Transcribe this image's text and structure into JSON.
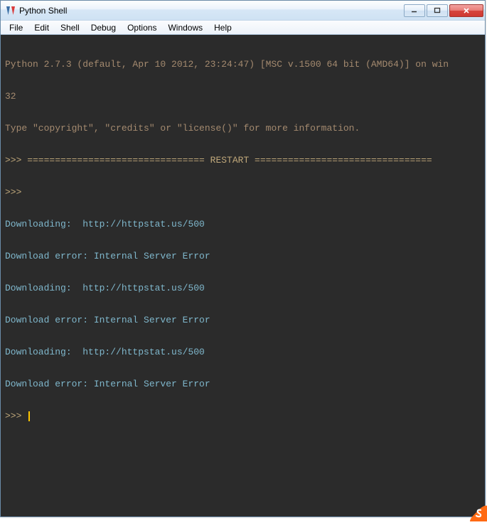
{
  "window": {
    "title": "Python Shell",
    "icon": "tk-icon",
    "controls": {
      "minimize": "─",
      "maximize": "☐",
      "close": "✕"
    }
  },
  "menu": {
    "items": [
      "File",
      "Edit",
      "Shell",
      "Debug",
      "Options",
      "Windows",
      "Help"
    ]
  },
  "console": {
    "header1": "Python 2.7.3 (default, Apr 10 2012, 23:24:47) [MSC v.1500 64 bit (AMD64)] on win",
    "header2": "32",
    "header3": "Type \"copyright\", \"credits\" or \"license()\" for more information.",
    "prompt": ">>> ",
    "restart_line": ">>> ================================ RESTART ================================",
    "lines": [
      {
        "t": "Downloading:  http://httpstat.us/500"
      },
      {
        "t": "Download error: Internal Server Error"
      },
      {
        "t": "Downloading:  http://httpstat.us/500"
      },
      {
        "t": "Download error: Internal Server Error"
      },
      {
        "t": "Downloading:  http://httpstat.us/500"
      },
      {
        "t": "Download error: Internal Server Error"
      }
    ]
  }
}
